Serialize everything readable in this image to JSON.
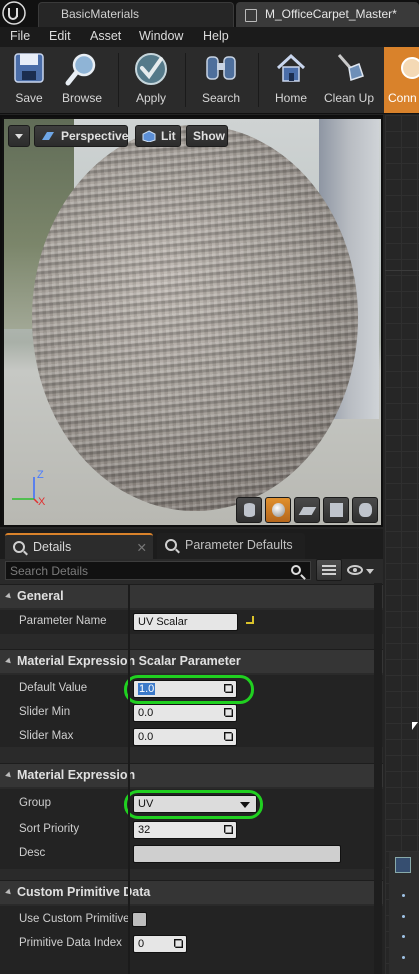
{
  "window": {
    "tabs": [
      {
        "label": "BasicMaterials"
      },
      {
        "label": "M_OfficeCarpet_Master*"
      }
    ]
  },
  "menu": [
    "File",
    "Edit",
    "Asset",
    "Window",
    "Help"
  ],
  "toolbar": {
    "save": "Save",
    "browse": "Browse",
    "apply": "Apply",
    "search": "Search",
    "home": "Home",
    "clean_up": "Clean Up",
    "connectors": "Conn"
  },
  "viewport": {
    "perspective": "Perspective",
    "lit": "Lit",
    "show": "Show",
    "axis_z": "Z",
    "axis_x": "X"
  },
  "panel_tabs": {
    "details": "Details",
    "parameter_defaults": "Parameter Defaults"
  },
  "search": {
    "placeholder": "Search Details"
  },
  "details": {
    "general": {
      "header": "General",
      "parameter_name_label": "Parameter Name",
      "parameter_name_value": "UV Scalar"
    },
    "scalar": {
      "header": "Material Expression Scalar Parameter",
      "default_value_label": "Default Value",
      "default_value": "1.0",
      "slider_min_label": "Slider Min",
      "slider_min": "0.0",
      "slider_max_label": "Slider Max",
      "slider_max": "0.0"
    },
    "expression": {
      "header": "Material Expression",
      "group_label": "Group",
      "group_value": "UV",
      "sort_priority_label": "Sort Priority",
      "sort_priority": "32",
      "desc_label": "Desc",
      "desc_value": ""
    },
    "custom_primitive": {
      "header": "Custom Primitive Data",
      "use_label": "Use Custom Primitive",
      "use_checked": false,
      "index_label": "Primitive Data Index",
      "index_value": "0"
    }
  },
  "colors": {
    "accent": "#d9822b",
    "highlight_ring": "#20d020"
  }
}
